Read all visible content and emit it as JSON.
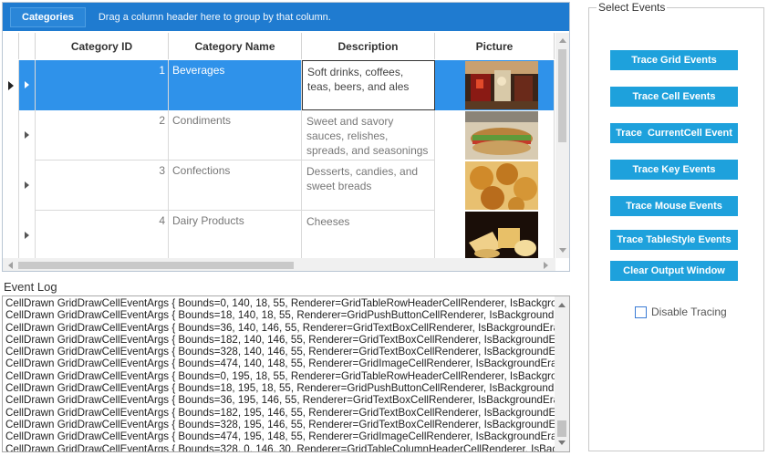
{
  "grid": {
    "group_chip": "Categories",
    "group_hint": "Drag a column header here to group by that column.",
    "columns": [
      "Category ID",
      "Category Name",
      "Description",
      "Picture"
    ],
    "rows": [
      {
        "id": "1",
        "name": "Beverages",
        "description": "Soft drinks, coffees, teas, beers, and ales",
        "picture": "beverages-image",
        "selected": true
      },
      {
        "id": "2",
        "name": "Condiments",
        "description": "Sweet and savory sauces, relishes, spreads, and seasonings",
        "picture": "condiments-image",
        "selected": false
      },
      {
        "id": "3",
        "name": "Confections",
        "description": "Desserts, candies, and sweet breads",
        "picture": "confections-image",
        "selected": false
      },
      {
        "id": "4",
        "name": "Dairy Products",
        "description": "Cheeses",
        "picture": "dairy-image",
        "selected": false
      }
    ]
  },
  "log": {
    "title": "Event Log",
    "lines": [
      "CellDrawn  GridDrawCellEventArgs { Bounds=0, 140, 18, 55, Renderer=GridTableRowHeaderCellRenderer, IsBackgroundErased",
      "CellDrawn  GridDrawCellEventArgs { Bounds=18, 140, 18, 55, Renderer=GridPushButtonCellRenderer, IsBackgroundErased",
      "CellDrawn  GridDrawCellEventArgs { Bounds=36, 140, 146, 55, Renderer=GridTextBoxCellRenderer, IsBackgroundErased",
      "CellDrawn  GridDrawCellEventArgs { Bounds=182, 140, 146, 55, Renderer=GridTextBoxCellRenderer, IsBackgroundErased",
      "CellDrawn  GridDrawCellEventArgs { Bounds=328, 140, 146, 55, Renderer=GridTextBoxCellRenderer, IsBackgroundErased",
      "CellDrawn  GridDrawCellEventArgs { Bounds=474, 140, 148, 55, Renderer=GridImageCellRenderer, IsBackgroundErased",
      "CellDrawn  GridDrawCellEventArgs { Bounds=0, 195, 18, 55, Renderer=GridTableRowHeaderCellRenderer, IsBackgroundErased",
      "CellDrawn  GridDrawCellEventArgs { Bounds=18, 195, 18, 55, Renderer=GridPushButtonCellRenderer, IsBackgroundErased",
      "CellDrawn  GridDrawCellEventArgs { Bounds=36, 195, 146, 55, Renderer=GridTextBoxCellRenderer, IsBackgroundErased",
      "CellDrawn  GridDrawCellEventArgs { Bounds=182, 195, 146, 55, Renderer=GridTextBoxCellRenderer, IsBackgroundErased",
      "CellDrawn  GridDrawCellEventArgs { Bounds=328, 195, 146, 55, Renderer=GridTextBoxCellRenderer, IsBackgroundErased",
      "CellDrawn  GridDrawCellEventArgs { Bounds=474, 195, 148, 55, Renderer=GridImageCellRenderer, IsBackgroundErased",
      "CellDrawn  GridDrawCellEventArgs { Bounds=328, 0, 146, 30, Renderer=GridTableColumnHeaderCellRenderer, IsBackgroundErased"
    ]
  },
  "events": {
    "legend": "Select Events",
    "buttons": [
      "Trace Grid Events",
      "Trace Cell Events",
      "Trace  CurrentCell Event",
      "Trace Key Events",
      "Trace Mouse Events",
      "Trace TableStyle Events",
      "Clear Output Window"
    ],
    "disable_tracing": "Disable Tracing"
  },
  "colors": {
    "group_bar": "#1f7bd0",
    "selection": "#2f92ea",
    "button": "#1ea1dc"
  }
}
